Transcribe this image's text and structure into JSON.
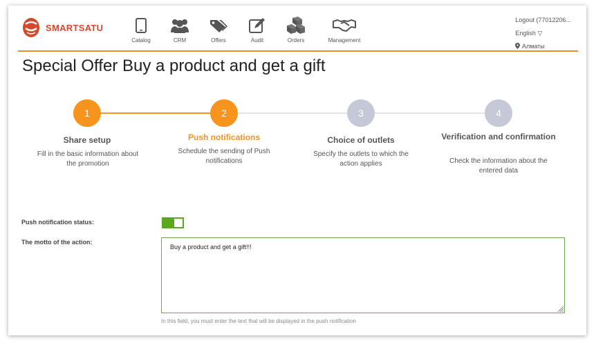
{
  "brand": {
    "name": "SMARTSATU"
  },
  "nav": {
    "items": [
      {
        "label": "Catalog",
        "icon": "tablet-icon"
      },
      {
        "label": "CRM",
        "icon": "users-icon"
      },
      {
        "label": "Offers",
        "icon": "tags-icon"
      },
      {
        "label": "Audit",
        "icon": "edit-icon"
      },
      {
        "label": "Orders",
        "icon": "boxes-icon"
      },
      {
        "label": "Management",
        "icon": "handshake-icon"
      }
    ]
  },
  "user": {
    "logout": "Logout (77012206...",
    "language": "English ▽",
    "city": "Алматы"
  },
  "page": {
    "title": "Special Offer Buy a product and get a gift"
  },
  "steps": [
    {
      "number": "1",
      "title": "Share setup",
      "desc": "Fill in the basic information about the promotion",
      "state": "done"
    },
    {
      "number": "2",
      "title": "Push notifications",
      "desc": "Schedule the sending of Push notifications",
      "state": "active"
    },
    {
      "number": "3",
      "title": "Choice of outlets",
      "desc": "Specify the outlets to which the action applies",
      "state": "pending"
    },
    {
      "number": "4",
      "title": "Verification and confirmation",
      "desc": "Check the information about the entered data",
      "state": "pending"
    }
  ],
  "form": {
    "push_status_label": "Push notification status:",
    "push_status_on": true,
    "motto_label": "The motto of the action:",
    "motto_value": "Buy a product and get a gift!!!",
    "motto_hint": "In this field, you must enter the text that will be displayed in the push notification"
  },
  "colors": {
    "accent": "#f7941d",
    "pending": "#c5c8d6",
    "toggle": "#5aa81c",
    "header_line": "#f08a2c"
  }
}
